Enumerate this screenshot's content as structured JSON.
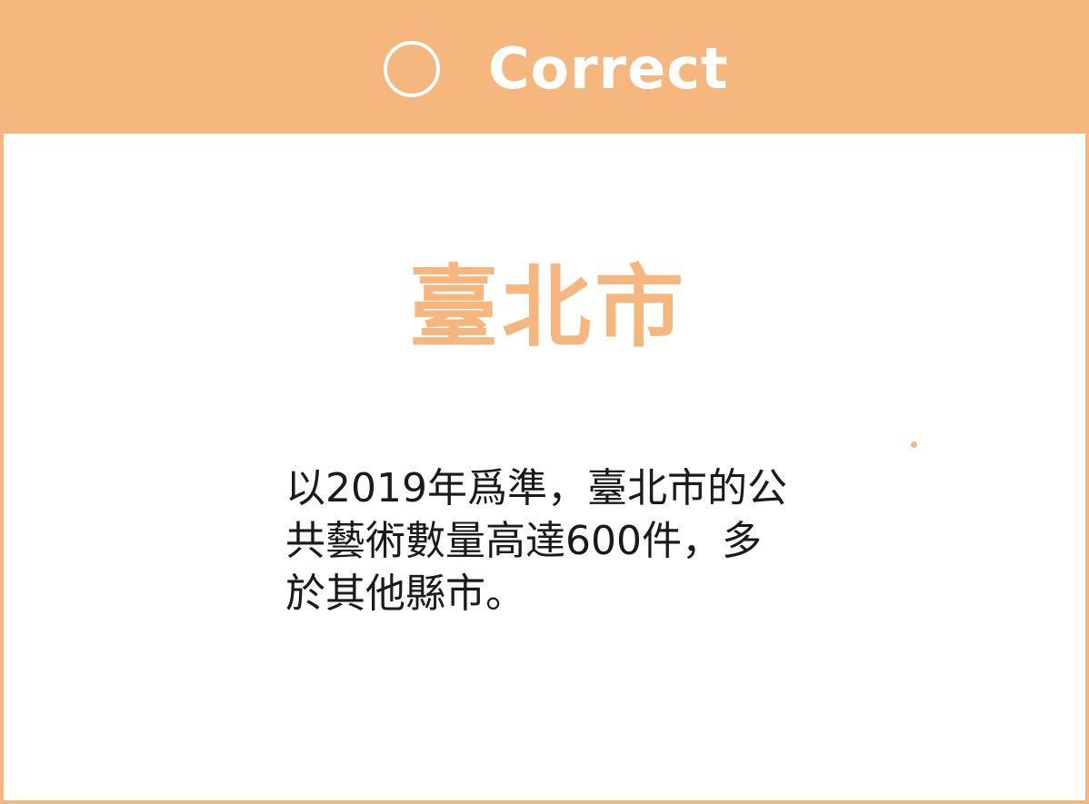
{
  "result": {
    "status_icon": "circle-icon",
    "status_label": "Correct"
  },
  "answer": {
    "title": "臺北市",
    "explanation_lines": [
      "以2019年爲準，臺北市的公",
      "共藝術數量高達600件，多",
      "於其他縣市。"
    ]
  },
  "colors": {
    "accent": "#f6b77f",
    "text": "#1a1a1a",
    "background": "#ffffff"
  }
}
